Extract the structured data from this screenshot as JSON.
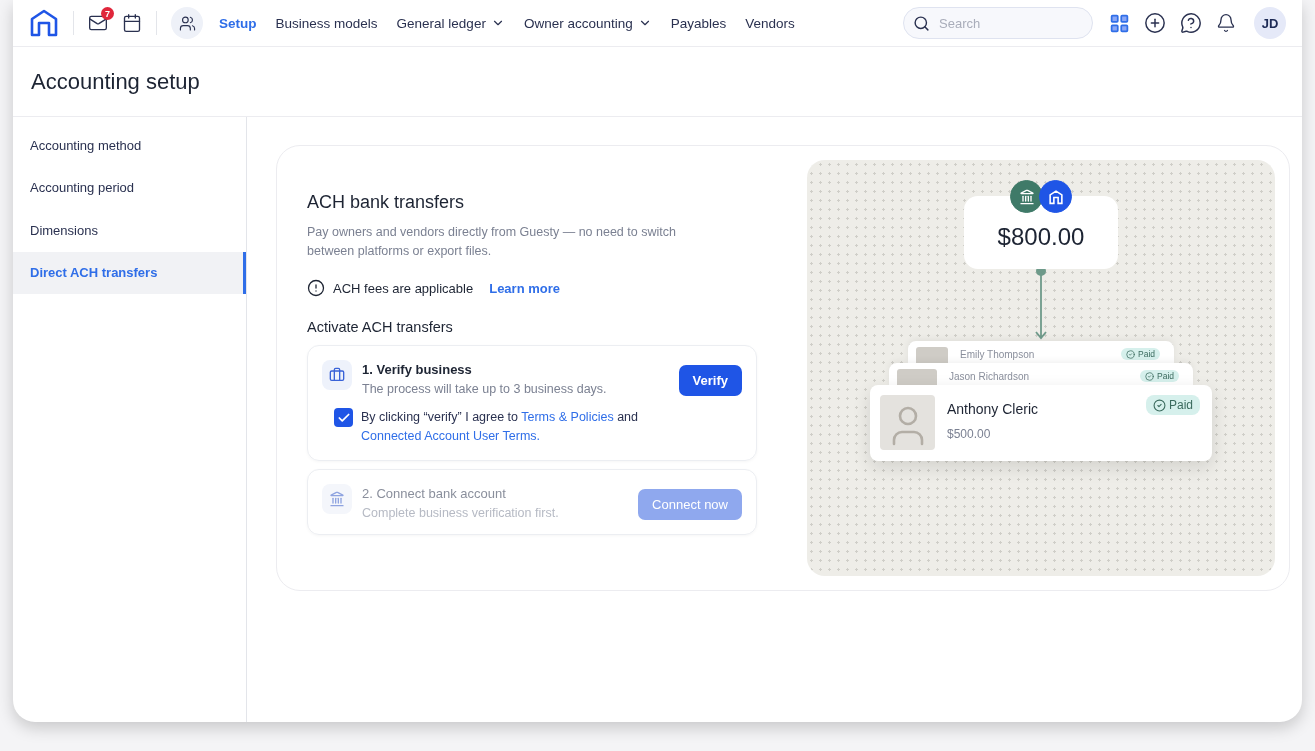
{
  "top_nav": {
    "notification_count": "7",
    "items": [
      {
        "label": "Setup",
        "kind": "link",
        "selected": true
      },
      {
        "label": "Business models",
        "kind": "link",
        "selected": false
      },
      {
        "label": "General ledger",
        "kind": "menu",
        "selected": false
      },
      {
        "label": "Owner accounting",
        "kind": "menu",
        "selected": false
      },
      {
        "label": "Payables",
        "kind": "link",
        "selected": false
      },
      {
        "label": "Vendors",
        "kind": "link",
        "selected": false
      }
    ],
    "search": {
      "placeholder": "Search"
    },
    "avatar": "JD"
  },
  "page_title": "Accounting setup",
  "sidebar": {
    "items": [
      {
        "label": "Accounting method",
        "selected": false
      },
      {
        "label": "Accounting period",
        "selected": false
      },
      {
        "label": "Dimensions",
        "selected": false
      },
      {
        "label": "Direct ACH transfers",
        "selected": true
      }
    ]
  },
  "ach": {
    "title": "ACH bank transfers",
    "description": "Pay owners and vendors directly from Guesty — no need to switch between platforms or export files.",
    "fee_note": "ACH fees are applicable",
    "learn_more": "Learn more",
    "section_title": "Activate ACH transfers",
    "steps": [
      {
        "kind": "verify",
        "title": "1. Verify business",
        "description": "The process will take up to 3 business days.",
        "button": "Verify",
        "disabled": false,
        "consent": {
          "checked": true,
          "text_before": "By clicking “verify” I agree to",
          "link_1": "Terms & Policies",
          "text_middle": "and",
          "link_2": "Connected Account User Terms."
        }
      },
      {
        "kind": "bank",
        "title": "2. Connect bank account",
        "description": "Complete business verification first.",
        "button": "Connect now",
        "disabled": true
      }
    ]
  },
  "illustration": {
    "amount": "$800.00",
    "payees": [
      {
        "name": "Emily Thompson",
        "status": "Paid"
      },
      {
        "name": "Jason Richardson",
        "status": "Paid"
      },
      {
        "name": "Anthony Cleric",
        "amount": "$500.00",
        "status": "Paid"
      }
    ]
  }
}
